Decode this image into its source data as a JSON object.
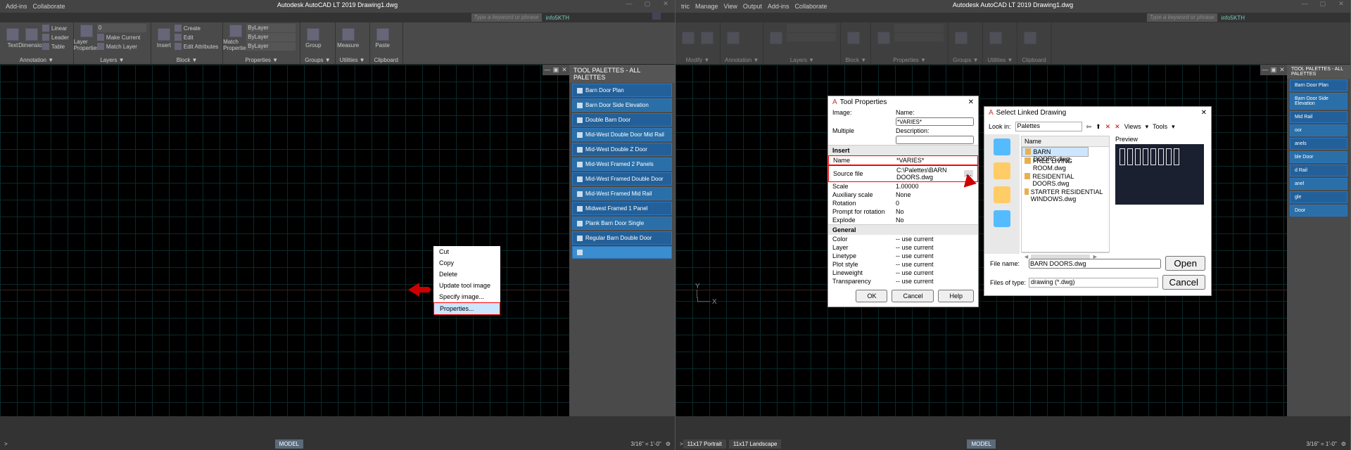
{
  "app": {
    "title": "Autodesk AutoCAD LT 2019   Drawing1.dwg"
  },
  "tabs": [
    "Add-ins",
    "Collaborate"
  ],
  "tabs_right": [
    "tric",
    "Manage",
    "View",
    "Output",
    "Add-ins",
    "Collaborate"
  ],
  "search_placeholder": "Type a keyword or phrase",
  "user": "info5KTH",
  "ribbon_groups": {
    "annotation": "Annotation ▼",
    "layers": "Layers ▼",
    "block": "Block ▼",
    "properties": "Properties ▼",
    "groups": "Groups ▼",
    "utilities": "Utilities ▼",
    "clipboard": "Clipboard",
    "modify": "Modify ▼"
  },
  "ribbon_btns": {
    "text": "Text",
    "dimension": "Dimension",
    "linear": "Linear",
    "leader": "Leader",
    "table": "Table",
    "layerprops": "Layer\nProperties",
    "insert": "Insert",
    "create": "Create",
    "edit": "Edit",
    "editattr": "Edit Attributes",
    "match": "Match\nProperties",
    "group": "Group",
    "measure": "Measure",
    "paste": "Paste",
    "bylayer": "ByLayer",
    "makecurrent": "Make Current",
    "matchlayer": "Match Layer",
    "multiple": "Multiple"
  },
  "palette": {
    "title": "TOOL PALETTES - ALL PALETTES",
    "items": [
      "Barn Door Plan",
      "Barn Door Side Elevation",
      "Double Barn Door",
      "Mid-West Double Door Mid Rail",
      "Mid-West Double Z Door",
      "Mid-West Framed 2 Panels",
      "Mid-West Framed Double Door",
      "Mid-West Framed Mid Rail",
      "Midwest Framed 1 Panel",
      "Plank Barn Door Single",
      "Regular Barn Double Door"
    ]
  },
  "ctx": [
    "Cut",
    "Copy",
    "Delete",
    "Update tool image",
    "Specify image...",
    "Properties..."
  ],
  "statusbar": {
    "model": "MODEL",
    "layout1": "11x17 Portrait",
    "layout2": "11x17 Landscape",
    "scale": "3/16\" = 1'-0\""
  },
  "toolprops": {
    "title": "Tool Properties",
    "image": "Image:",
    "name": "Name:",
    "desc": "Description:",
    "multiple": "Multiple",
    "varies": "*VARIES*",
    "sections": {
      "insert": "Insert",
      "general": "General"
    },
    "rows": {
      "name": "Name",
      "srcfile": "Source file",
      "scale": "Scale",
      "auxscale": "Auxiliary scale",
      "rot": "Rotation",
      "prompt": "Prompt for rotation",
      "explode": "Explode",
      "color": "Color",
      "layer": "Layer",
      "linetype": "Linetype",
      "plotstyle": "Plot style",
      "lineweight": "Lineweight",
      "transp": "Transparency"
    },
    "vals": {
      "name": "*VARIES*",
      "srcfile": "C:\\Palettes\\BARN DOORS.dwg",
      "scale": "1.00000",
      "auxscale": "None",
      "rot": "0",
      "prompt": "No",
      "explode": "No",
      "usecurr": "-- use current"
    },
    "btns": {
      "ok": "OK",
      "cancel": "Cancel",
      "help": "Help"
    }
  },
  "filedlg": {
    "title": "Select Linked Drawing",
    "lookin": "Look in:",
    "lookval": "Palettes",
    "views": "Views",
    "tools": "Tools",
    "name_hd": "Name",
    "prev": "Preview",
    "files": [
      "BARN DOORS.dwg",
      "FREE LIVING ROOM.dwg",
      "RESIDENTIAL DOORS.dwg",
      "STARTER RESIDENTIAL WINDOWS.dwg"
    ],
    "filename_lbl": "File name:",
    "filename": "BARN DOORS.dwg",
    "type_lbl": "Files of type:",
    "type": "drawing (*.dwg)",
    "open": "Open",
    "cancel": "Cancel"
  }
}
